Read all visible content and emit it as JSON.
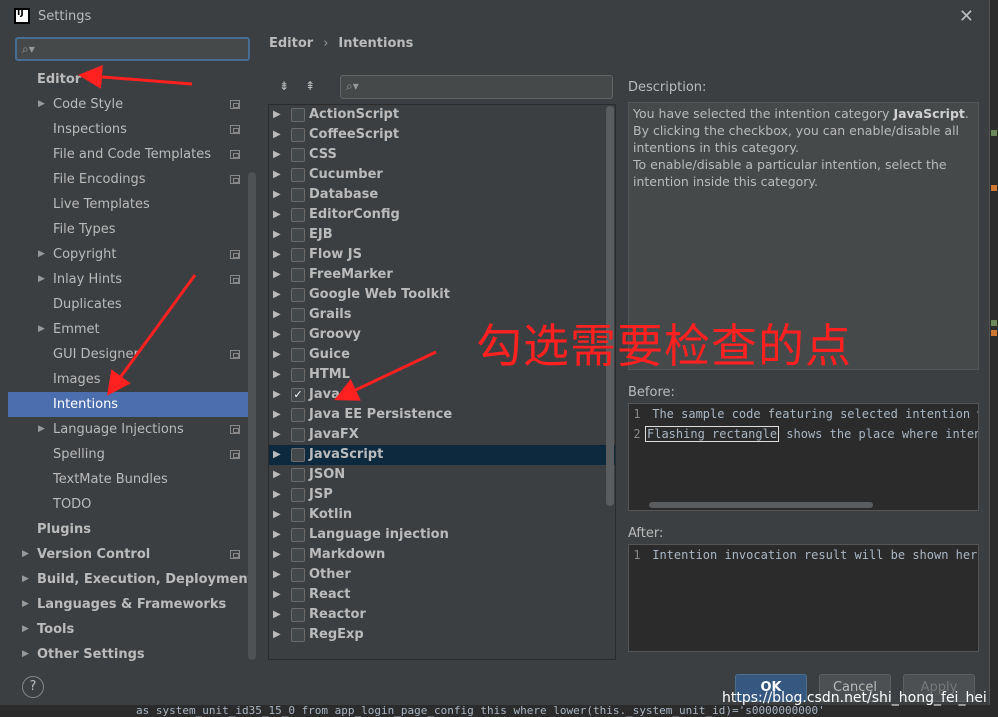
{
  "window": {
    "title": "Settings"
  },
  "search": {
    "placeholder": ""
  },
  "sidebar": {
    "items": [
      {
        "label": "Editor",
        "bold": true,
        "arrow": false,
        "copy": false,
        "indent": 0,
        "expanded": true
      },
      {
        "label": "Code Style",
        "arrow": true,
        "copy": true,
        "indent": 1
      },
      {
        "label": "Inspections",
        "arrow": false,
        "copy": true,
        "indent": 1
      },
      {
        "label": "File and Code Templates",
        "arrow": false,
        "copy": true,
        "indent": 1
      },
      {
        "label": "File Encodings",
        "arrow": false,
        "copy": true,
        "indent": 1
      },
      {
        "label": "Live Templates",
        "arrow": false,
        "copy": false,
        "indent": 1
      },
      {
        "label": "File Types",
        "arrow": false,
        "copy": false,
        "indent": 1
      },
      {
        "label": "Copyright",
        "arrow": true,
        "copy": true,
        "indent": 1
      },
      {
        "label": "Inlay Hints",
        "arrow": true,
        "copy": true,
        "indent": 1
      },
      {
        "label": "Duplicates",
        "arrow": false,
        "copy": false,
        "indent": 1
      },
      {
        "label": "Emmet",
        "arrow": true,
        "copy": false,
        "indent": 1
      },
      {
        "label": "GUI Designer",
        "arrow": false,
        "copy": true,
        "indent": 1
      },
      {
        "label": "Images",
        "arrow": false,
        "copy": false,
        "indent": 1
      },
      {
        "label": "Intentions",
        "arrow": false,
        "copy": false,
        "indent": 1,
        "selected": true
      },
      {
        "label": "Language Injections",
        "arrow": true,
        "copy": true,
        "indent": 1
      },
      {
        "label": "Spelling",
        "arrow": false,
        "copy": true,
        "indent": 1
      },
      {
        "label": "TextMate Bundles",
        "arrow": false,
        "copy": false,
        "indent": 1
      },
      {
        "label": "TODO",
        "arrow": false,
        "copy": false,
        "indent": 1
      },
      {
        "label": "Plugins",
        "bold": true,
        "arrow": false,
        "copy": false,
        "indent": 0
      },
      {
        "label": "Version Control",
        "bold": true,
        "arrow": true,
        "copy": true,
        "indent": 0
      },
      {
        "label": "Build, Execution, Deployment",
        "bold": true,
        "arrow": true,
        "copy": false,
        "indent": 0
      },
      {
        "label": "Languages & Frameworks",
        "bold": true,
        "arrow": true,
        "copy": false,
        "indent": 0
      },
      {
        "label": "Tools",
        "bold": true,
        "arrow": true,
        "copy": false,
        "indent": 0
      },
      {
        "label": "Other Settings",
        "bold": true,
        "arrow": true,
        "copy": false,
        "indent": 0
      }
    ]
  },
  "breadcrumb": {
    "parent": "Editor",
    "separator": "›",
    "current": "Intentions"
  },
  "toolbar": {
    "expand_all": "⇟",
    "collapse_all": "⇞"
  },
  "filter": {
    "placeholder": ""
  },
  "intentions": [
    {
      "name": "ActionScript",
      "checked": false
    },
    {
      "name": "CoffeeScript",
      "checked": false
    },
    {
      "name": "CSS",
      "checked": false
    },
    {
      "name": "Cucumber",
      "checked": false
    },
    {
      "name": "Database",
      "checked": false
    },
    {
      "name": "EditorConfig",
      "checked": false
    },
    {
      "name": "EJB",
      "checked": false
    },
    {
      "name": "Flow JS",
      "checked": false
    },
    {
      "name": "FreeMarker",
      "checked": false
    },
    {
      "name": "Google Web Toolkit",
      "checked": false
    },
    {
      "name": "Grails",
      "checked": false
    },
    {
      "name": "Groovy",
      "checked": false
    },
    {
      "name": "Guice",
      "checked": false
    },
    {
      "name": "HTML",
      "checked": false
    },
    {
      "name": "Java",
      "checked": true
    },
    {
      "name": "Java EE Persistence",
      "checked": false
    },
    {
      "name": "JavaFX",
      "checked": false
    },
    {
      "name": "JavaScript",
      "checked": false,
      "selected": true
    },
    {
      "name": "JSON",
      "checked": false
    },
    {
      "name": "JSP",
      "checked": false
    },
    {
      "name": "Kotlin",
      "checked": false
    },
    {
      "name": "Language injection",
      "checked": false
    },
    {
      "name": "Markdown",
      "checked": false
    },
    {
      "name": "Other",
      "checked": false
    },
    {
      "name": "React",
      "checked": false
    },
    {
      "name": "Reactor",
      "checked": false
    },
    {
      "name": "RegExp",
      "checked": false
    }
  ],
  "description": {
    "label": "Description:",
    "line1_prefix": "You have selected the intention category ",
    "line1_bold": "JavaScript",
    "line1_suffix": ".",
    "line2": "By clicking the checkbox, you can enable/disable all intentions in this category.",
    "line3": "To enable/disable a particular intention, select the intention inside this category."
  },
  "before": {
    "label": "Before:",
    "lines": [
      {
        "num": "1",
        "text": "The sample code featuring selected intention wil"
      },
      {
        "num": "2",
        "flash": "Flashing rectangle",
        "rest": " shows the place where intenti"
      }
    ]
  },
  "after": {
    "label": "After:",
    "lines": [
      {
        "num": "1",
        "text": "Intention invocation result will be shown here."
      }
    ]
  },
  "annotation": {
    "text": "勾选需要检查的点",
    "color": "#ff2020"
  },
  "footer": {
    "help": "?",
    "ok": "OK",
    "cancel": "Cancel",
    "apply": "Apply"
  },
  "watermark": "https://blog.csdn.net/shi_hong_fei_hei",
  "background_code": "as system_unit_id35_15_0  from app_login_page_config this  where lower(this._system_unit_id)='s0000000000'",
  "colors": {
    "selection": "#4b6eaf",
    "list_selection": "#0d293e",
    "accent_red": "#ff2020"
  }
}
